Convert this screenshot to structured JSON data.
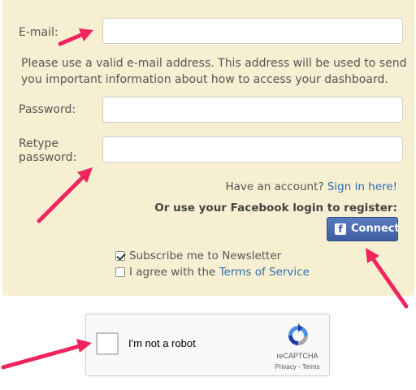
{
  "form": {
    "email_label": "E-mail:",
    "email_value": "",
    "help_text": "Please use a valid e-mail address. This address will be used to send you important information about how to access your dashboard.",
    "password_label": "Password:",
    "password_value": "",
    "retype_label_1": "Retype",
    "retype_label_2": "password:",
    "retype_value": "",
    "have_account": "Have an account?",
    "sign_in_link": "Sign in here!",
    "facebook_prompt": "Or use your Facebook login to register:",
    "facebook_button": "Connect",
    "facebook_logo": "f",
    "subscribe_label": "Subscribe me to Newsletter",
    "subscribe_checked": true,
    "agree_prefix": "I agree with the",
    "terms_link": "Terms of Service",
    "agree_checked": false
  },
  "recaptcha": {
    "label": "I'm not a robot",
    "brand": "reCAPTCHA",
    "privacy": "Privacy",
    "separator": " - ",
    "terms": "Terms"
  },
  "colors": {
    "panel_bg": "#f7efd2",
    "link": "#2a6fb0",
    "facebook_blue": "#3d5ea4",
    "arrow": "#f0245f"
  },
  "icons": [
    "facebook-icon",
    "recaptcha-logo-icon",
    "pink-arrow-icon"
  ]
}
